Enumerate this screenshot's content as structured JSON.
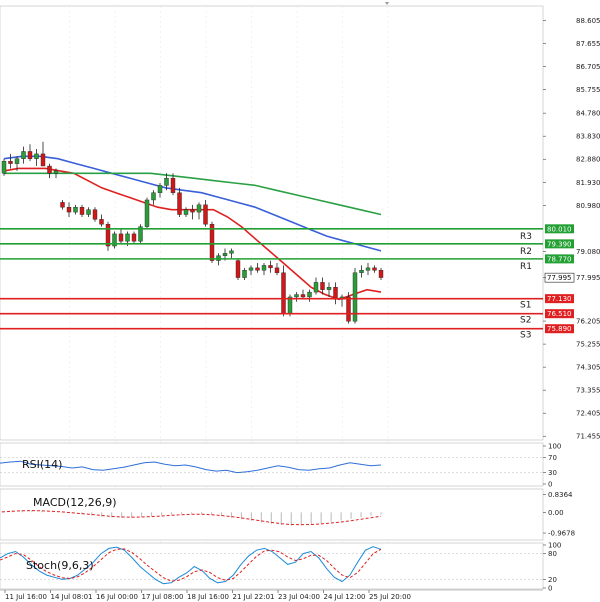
{
  "chart_data": {
    "type": "candlestick",
    "price_axis": {
      "ticks": [
        "88.605",
        "87.655",
        "86.705",
        "85.755",
        "84.780",
        "83.830",
        "82.880",
        "81.930",
        "80.980",
        "79.080",
        "77.995",
        "76.205",
        "75.255",
        "74.305",
        "73.355",
        "72.405",
        "71.455"
      ],
      "ylim": [
        71.3,
        89.2
      ]
    },
    "levels": [
      {
        "name": "R3",
        "value": 80.01,
        "label": "80.010",
        "color": "#22a034"
      },
      {
        "name": "R2",
        "value": 79.39,
        "label": "79.390",
        "color": "#22a034"
      },
      {
        "name": "R1",
        "value": 78.77,
        "label": "78.770",
        "color": "#22a034"
      },
      {
        "name": "S1",
        "value": 77.13,
        "label": "77.130",
        "color": "#e02020"
      },
      {
        "name": "S2",
        "value": 76.51,
        "label": "76.510",
        "color": "#e02020"
      },
      {
        "name": "S3",
        "value": 75.89,
        "label": "75.890",
        "color": "#e02020"
      }
    ],
    "current_price": {
      "value": 77.995,
      "label": "77.995"
    },
    "x_labels": [
      "11 Jul 16:00",
      "14 Jul 08:01",
      "16 Jul 00:00",
      "17 Jul 08:00",
      "18 Jul 16:00",
      "21 Jul 22:01",
      "23 Jul 04:00",
      "24 Jul 12:00",
      "25 Jul 20:00"
    ],
    "candles": [
      [
        82.3,
        82.9,
        82.2,
        82.8
      ],
      [
        82.8,
        83.1,
        82.5,
        82.7
      ],
      [
        82.7,
        83.0,
        82.4,
        82.9
      ],
      [
        82.9,
        83.4,
        82.7,
        83.2
      ],
      [
        83.2,
        83.5,
        82.8,
        82.9
      ],
      [
        82.9,
        83.3,
        82.6,
        83.1
      ],
      [
        83.1,
        83.6,
        82.9,
        82.6
      ],
      [
        82.6,
        82.7,
        82.1,
        82.3
      ],
      [
        82.3,
        82.5,
        82.1,
        82.4
      ],
      [
        81.1,
        81.2,
        80.8,
        80.9
      ],
      [
        80.9,
        81.1,
        80.5,
        80.7
      ],
      [
        80.7,
        81.0,
        80.6,
        80.9
      ],
      [
        80.9,
        81.0,
        80.5,
        80.6
      ],
      [
        80.6,
        80.9,
        80.5,
        80.8
      ],
      [
        80.8,
        80.9,
        80.3,
        80.4
      ],
      [
        80.4,
        80.6,
        80.1,
        80.2
      ],
      [
        80.2,
        80.3,
        79.1,
        79.3
      ],
      [
        79.3,
        79.9,
        79.2,
        79.8
      ],
      [
        79.8,
        80.0,
        79.4,
        79.5
      ],
      [
        79.5,
        79.9,
        79.3,
        79.8
      ],
      [
        79.8,
        79.9,
        79.4,
        79.5
      ],
      [
        79.5,
        80.2,
        79.4,
        80.1
      ],
      [
        80.1,
        81.3,
        80.0,
        81.2
      ],
      [
        81.2,
        81.6,
        81.0,
        81.5
      ],
      [
        81.5,
        81.9,
        81.3,
        81.8
      ],
      [
        81.8,
        82.3,
        81.6,
        82.1
      ],
      [
        82.1,
        82.3,
        81.4,
        81.5
      ],
      [
        81.5,
        81.7,
        80.5,
        80.6
      ],
      [
        80.6,
        80.9,
        80.5,
        80.8
      ],
      [
        80.8,
        81.0,
        80.4,
        80.7
      ],
      [
        80.7,
        81.1,
        80.4,
        81.0
      ],
      [
        81.0,
        81.2,
        80.1,
        80.2
      ],
      [
        80.2,
        80.3,
        78.6,
        78.7
      ],
      [
        78.7,
        79.0,
        78.5,
        78.9
      ],
      [
        78.9,
        79.2,
        78.7,
        79.0
      ],
      [
        79.0,
        79.2,
        78.8,
        79.1
      ],
      [
        78.7,
        78.8,
        77.9,
        78.0
      ],
      [
        78.0,
        78.4,
        77.9,
        78.3
      ],
      [
        78.3,
        78.5,
        78.1,
        78.4
      ],
      [
        78.4,
        78.6,
        78.2,
        78.3
      ],
      [
        78.3,
        78.6,
        78.1,
        78.5
      ],
      [
        78.5,
        78.7,
        78.2,
        78.4
      ],
      [
        78.4,
        78.6,
        78.1,
        78.2
      ],
      [
        78.2,
        78.5,
        76.4,
        76.5
      ],
      [
        76.5,
        77.3,
        76.4,
        77.2
      ],
      [
        77.2,
        77.4,
        77.0,
        77.3
      ],
      [
        77.3,
        77.5,
        77.1,
        77.2
      ],
      [
        77.2,
        77.5,
        77.0,
        77.4
      ],
      [
        77.4,
        78.0,
        77.3,
        77.8
      ],
      [
        77.8,
        78.0,
        77.3,
        77.5
      ],
      [
        77.5,
        77.8,
        77.2,
        77.6
      ],
      [
        77.6,
        77.8,
        76.9,
        77.1
      ],
      [
        77.1,
        77.3,
        76.8,
        77.2
      ],
      [
        77.2,
        77.4,
        76.1,
        76.2
      ],
      [
        76.2,
        78.4,
        76.1,
        78.2
      ],
      [
        78.2,
        78.5,
        78.0,
        78.3
      ],
      [
        78.3,
        78.6,
        78.1,
        78.4
      ],
      [
        78.4,
        78.5,
        78.2,
        78.3
      ],
      [
        78.3,
        78.4,
        77.9,
        78.0
      ]
    ],
    "moving_averages": [
      {
        "color": "#e02020",
        "values": [
          82.4,
          82.5,
          82.5,
          82.5,
          82.4,
          82.3,
          82.0,
          81.7,
          81.5,
          81.3,
          81.1,
          80.9,
          80.8,
          80.8,
          80.8,
          80.8,
          80.5,
          80.1,
          79.6,
          79.1,
          78.6,
          78.1,
          77.6,
          77.3,
          77.1,
          77.3,
          77.5,
          77.4
        ]
      },
      {
        "color": "#3a5fd8",
        "values": [
          82.9,
          83.0,
          83.0,
          82.9,
          82.7,
          82.5,
          82.3,
          82.1,
          81.9,
          81.7,
          81.6,
          81.5,
          81.3,
          81.1,
          80.9,
          80.6,
          80.3,
          80.0,
          79.7,
          79.5,
          79.3,
          79.1
        ]
      },
      {
        "color": "#2aa044",
        "values": [
          82.3,
          82.3,
          82.3,
          82.3,
          82.3,
          82.3,
          82.3,
          82.3,
          82.2,
          82.1,
          82.0,
          81.9,
          81.8,
          81.6,
          81.4,
          81.2,
          81.0,
          80.8,
          80.6
        ]
      }
    ],
    "rsi": {
      "label": "RSI(14)",
      "ticks": [
        "100",
        "70",
        "30",
        "0"
      ],
      "range": [
        0,
        100
      ],
      "values": [
        55,
        58,
        60,
        52,
        50,
        48,
        46,
        42,
        45,
        38,
        36,
        40,
        44,
        50,
        56,
        58,
        52,
        48,
        50,
        45,
        38,
        34,
        36,
        30,
        32,
        36,
        42,
        48,
        44,
        38,
        36,
        40,
        42,
        50,
        56,
        52,
        48,
        50
      ]
    },
    "macd": {
      "label": "MACD(12,26,9)",
      "ticks": [
        "0.8364",
        "0.00",
        "-0.9678"
      ],
      "range": [
        -1.2,
        0.95
      ],
      "histogram": [
        0.05,
        0.08,
        0.1,
        0.09,
        0.06,
        0.03,
        -0.02,
        -0.05,
        -0.1,
        -0.15,
        -0.2,
        -0.24,
        -0.26,
        -0.25,
        -0.22,
        -0.18,
        -0.14,
        -0.1,
        -0.08,
        -0.06,
        -0.08,
        -0.12,
        -0.18,
        -0.25,
        -0.32,
        -0.4,
        -0.48,
        -0.55,
        -0.6,
        -0.62,
        -0.6,
        -0.56,
        -0.5,
        -0.44,
        -0.38,
        -0.3,
        -0.22,
        -0.15,
        -0.1
      ],
      "signal": [
        0.02,
        0.05,
        0.07,
        0.08,
        0.07,
        0.05,
        0.02,
        -0.02,
        -0.06,
        -0.1,
        -0.15,
        -0.19,
        -0.22,
        -0.23,
        -0.22,
        -0.2,
        -0.17,
        -0.14,
        -0.11,
        -0.09,
        -0.09,
        -0.11,
        -0.15,
        -0.2,
        -0.26,
        -0.33,
        -0.4,
        -0.47,
        -0.53,
        -0.57,
        -0.58,
        -0.57,
        -0.54,
        -0.5,
        -0.45,
        -0.39,
        -0.32,
        -0.25,
        -0.18
      ]
    },
    "stoch": {
      "label": "Stoch(9,6,3)",
      "ticks": [
        "100",
        "80",
        "20",
        "0"
      ],
      "range": [
        0,
        100
      ],
      "k": [
        70,
        80,
        85,
        72,
        55,
        40,
        30,
        25,
        20,
        22,
        30,
        45,
        60,
        80,
        92,
        95,
        88,
        70,
        50,
        35,
        20,
        10,
        12,
        25,
        35,
        50,
        40,
        22,
        12,
        15,
        30,
        55,
        75,
        88,
        92,
        85,
        70,
        55,
        60,
        80,
        85,
        70,
        45,
        25,
        15,
        30,
        60,
        88,
        96,
        90
      ],
      "d": [
        65,
        72,
        80,
        78,
        65,
        50,
        38,
        30,
        24,
        22,
        26,
        36,
        50,
        66,
        82,
        90,
        91,
        82,
        68,
        52,
        38,
        24,
        16,
        18,
        26,
        38,
        42,
        36,
        24,
        18,
        22,
        38,
        56,
        74,
        86,
        88,
        84,
        72,
        64,
        68,
        76,
        76,
        64,
        46,
        30,
        24,
        36,
        58,
        80,
        90
      ]
    }
  }
}
